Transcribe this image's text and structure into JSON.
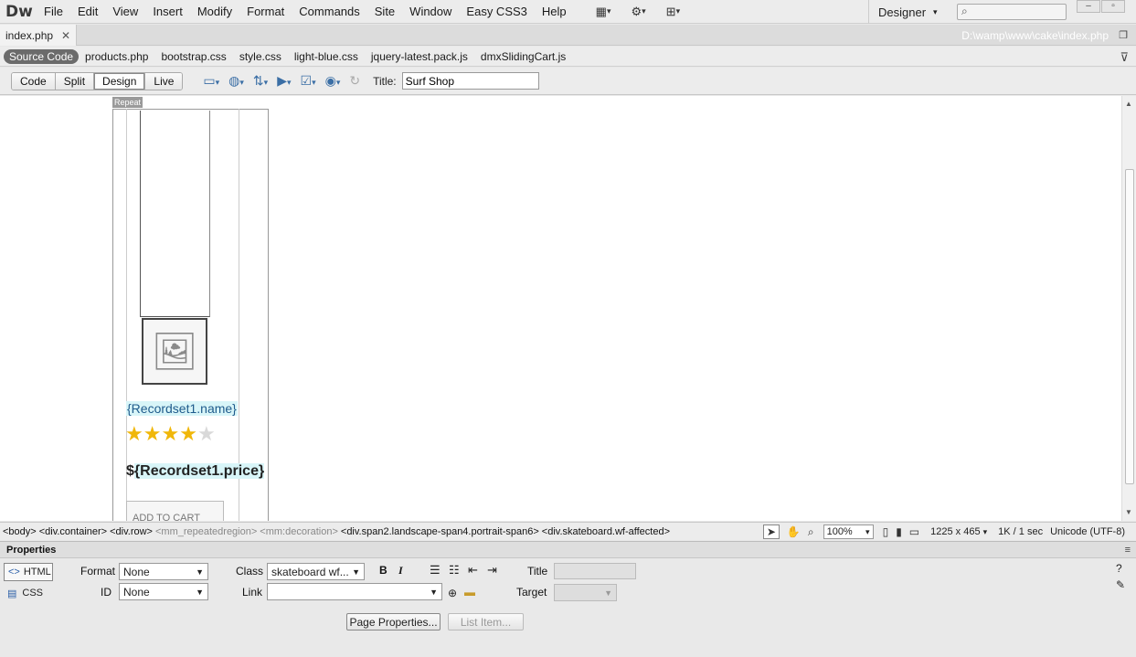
{
  "app": {
    "logo": "Dw"
  },
  "menu": [
    "File",
    "Edit",
    "View",
    "Insert",
    "Modify",
    "Format",
    "Commands",
    "Site",
    "Window",
    "Easy CSS3",
    "Help"
  ],
  "toolbar_icons": [
    "layout-icon",
    "gear-icon",
    "site-icon"
  ],
  "workspace": "Designer",
  "document": {
    "tab": "index.php",
    "path": "D:\\wamp\\www\\cake\\index.php"
  },
  "related_files": [
    "Source Code",
    "products.php",
    "bootstrap.css",
    "style.css",
    "light-blue.css",
    "jquery-latest.pack.js",
    "dmxSlidingCart.js"
  ],
  "views": [
    "Code",
    "Split",
    "Design",
    "Live"
  ],
  "active_view": "Design",
  "title_label": "Title:",
  "title_value": "Surf Shop",
  "canvas": {
    "repeat_tag": "Repeat",
    "record_name": "{Recordset1.name}",
    "price_prefix": "$",
    "record_price": "{Recordset1.price}",
    "rating": 4,
    "rating_max": 5,
    "cart_button": "ADD TO CART"
  },
  "tag_selector": [
    "<body>",
    "<div.container>",
    "<div.row>",
    "<mm_repeatedregion>",
    "<mm:decoration>",
    "<div.span2.landscape-span4.portrait-span6>",
    "<div.skateboard.wf-affected>"
  ],
  "status": {
    "zoom": "100%",
    "dimensions": "1225 x 465",
    "size": "1K / 1 sec",
    "encoding": "Unicode (UTF-8)"
  },
  "properties": {
    "header": "Properties",
    "html_mode": "HTML",
    "css_mode": "CSS",
    "format_label": "Format",
    "format_value": "None",
    "id_label": "ID",
    "id_value": "None",
    "class_label": "Class",
    "class_value": "skateboard wf...",
    "link_label": "Link",
    "title_label": "Title",
    "target_label": "Target",
    "page_properties": "Page Properties...",
    "list_item": "List Item..."
  }
}
